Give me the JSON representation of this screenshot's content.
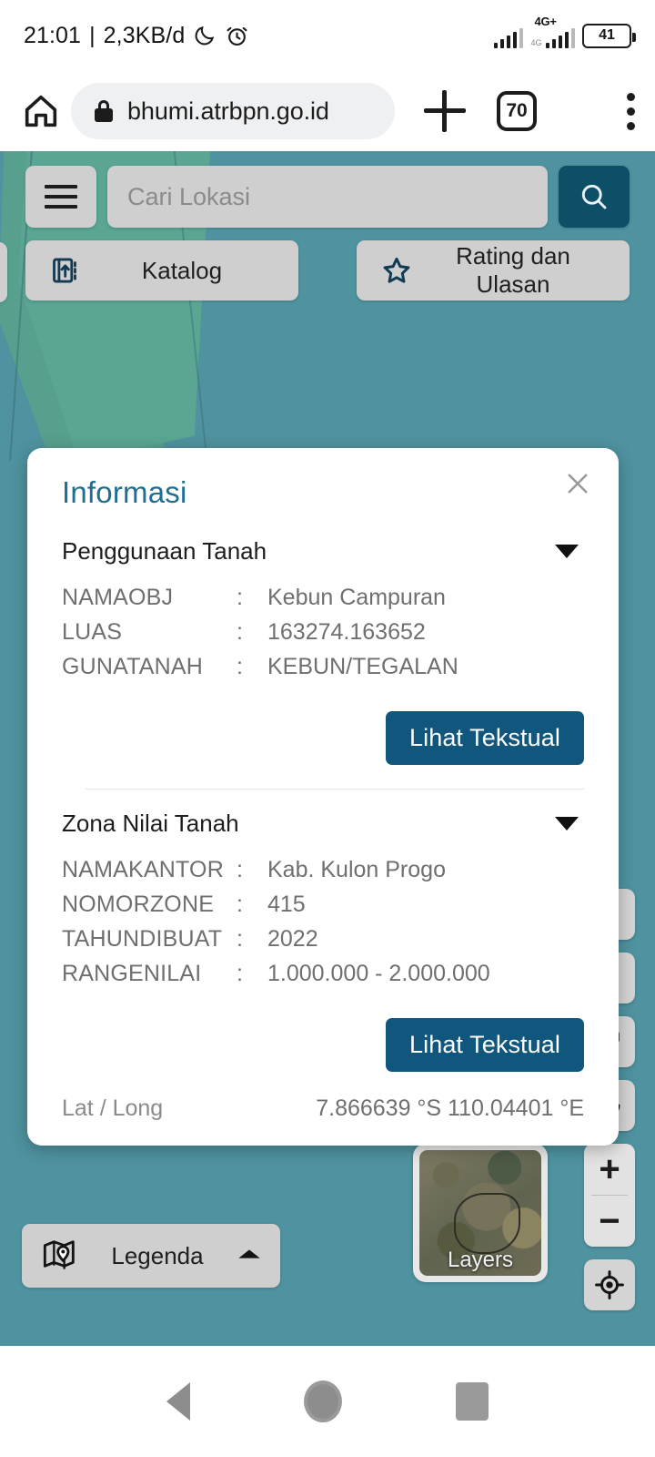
{
  "status_bar": {
    "time": "21:01",
    "separator": "|",
    "data_rate": "2,3KB/d",
    "dnd_icon": "moon-icon",
    "alarm_icon": "alarm-icon",
    "network_type": "4G+",
    "network_sub": "4G",
    "battery_level": "41"
  },
  "browser": {
    "home_icon": "home-icon",
    "lock_icon": "lock-icon",
    "url": "bhumi.atrbpn.go.id",
    "new_tab_icon": "plus-icon",
    "tab_count": "70",
    "menu_icon": "kebab-menu-icon"
  },
  "map_toolbar": {
    "menu_icon": "hamburger-menu-icon",
    "search_placeholder": "Cari Lokasi",
    "search_icon": "search-icon",
    "katalog": {
      "label": "Katalog",
      "icon": "catalog-book-icon"
    },
    "rating": {
      "label": "Rating dan Ulasan",
      "icon": "star-icon"
    }
  },
  "info_panel": {
    "close_icon": "close-icon",
    "title": "Informasi",
    "sections": [
      {
        "heading": "Penggunaan Tanah",
        "caret_icon": "chevron-down-icon",
        "rows": [
          {
            "key": "NAMAOBJ",
            "sep": ":",
            "value": "Kebun Campuran"
          },
          {
            "key": "LUAS",
            "sep": ":",
            "value": "163274.163652"
          },
          {
            "key": "GUNATANAH",
            "sep": ":",
            "value": "KEBUN/TEGALAN"
          }
        ],
        "button_label": "Lihat Tekstual"
      },
      {
        "heading": "Zona Nilai Tanah",
        "caret_icon": "chevron-down-icon",
        "rows": [
          {
            "key": "NAMAKANTOR",
            "sep": ":",
            "value": "Kab. Kulon Progo"
          },
          {
            "key": "NOMORZONE",
            "sep": ":",
            "value": "415"
          },
          {
            "key": "TAHUNDIBUAT",
            "sep": ":",
            "value": "2022"
          },
          {
            "key": "RANGENILAI",
            "sep": ":",
            "value": "1.000.000 - 2.000.000"
          }
        ],
        "button_label": "Lihat Tekstual"
      }
    ],
    "latlong_label": "Lat / Long",
    "latlong_value": "7.866639 °S  110.04401 °E"
  },
  "map_controls": {
    "measure_icon": "measure-ruler-icon",
    "refresh_icon": "refresh-icon",
    "zoom_in_label": "+",
    "zoom_out_label": "−",
    "locate_icon": "locate-crosshair-icon"
  },
  "bottom": {
    "legenda_label": "Legenda",
    "legenda_icon": "map-pin-legend-icon",
    "legenda_caret_icon": "chevron-up-icon",
    "layers_label": "Layers"
  },
  "nav_bar": {
    "back_icon": "back-triangle-icon",
    "home_icon": "home-circle-icon",
    "recents_icon": "recents-square-icon"
  },
  "colors": {
    "map_base": "#4f93a0",
    "map_polygon": "#5aa693",
    "accent_dark_blue": "#0d4f66",
    "button_blue": "#11567c",
    "title_blue": "#1f6f94",
    "chip_gray": "#cfcfcf"
  }
}
